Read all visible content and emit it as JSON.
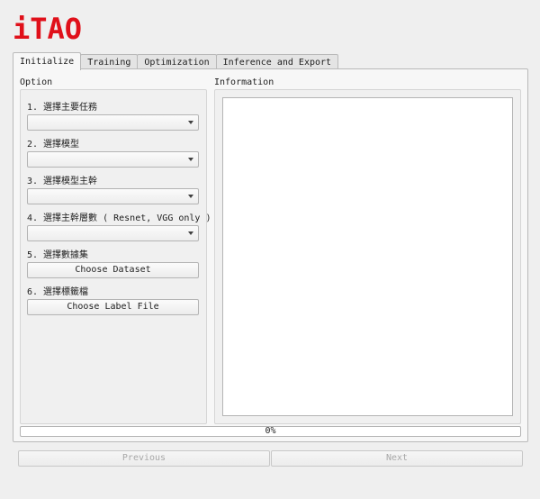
{
  "app": {
    "logo": "iTAO"
  },
  "tabs": [
    "Initialize",
    "Training",
    "Optimization",
    "Inference and Export"
  ],
  "option": {
    "title": "Option",
    "steps": [
      {
        "label": "1. 選擇主要任務",
        "control": "combo",
        "value": ""
      },
      {
        "label": "2. 選擇模型",
        "control": "combo",
        "value": ""
      },
      {
        "label": "3. 選擇模型主幹",
        "control": "combo",
        "value": ""
      },
      {
        "label": "4. 選擇主幹層數 ( Resnet, VGG only )",
        "control": "combo",
        "value": ""
      },
      {
        "label": "5. 選擇數據集",
        "control": "button",
        "button_label": "Choose Dataset"
      },
      {
        "label": "6. 選擇標籤檔",
        "control": "button",
        "button_label": "Choose Label File"
      }
    ]
  },
  "information": {
    "title": "Information",
    "text": ""
  },
  "progress": {
    "value": 0,
    "text": "0%"
  },
  "nav": {
    "previous": "Previous",
    "next": "Next"
  },
  "colors": {
    "logo": "#e0101a",
    "disabled_text": "#a8a8a8"
  }
}
